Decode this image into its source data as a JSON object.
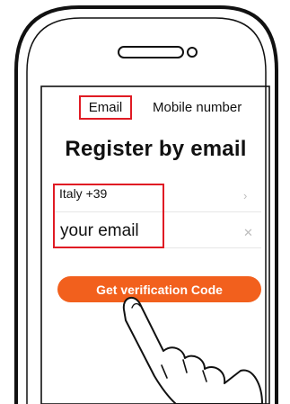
{
  "tabs": {
    "email": "Email",
    "mobile": "Mobile number"
  },
  "page": {
    "title": "Register by email"
  },
  "form": {
    "country": "Italy +39",
    "email_placeholder": "your email",
    "country_chevron_icon": "chevron-right-icon",
    "clear_icon": "close-icon"
  },
  "actions": {
    "get_code": "Get verification Code"
  },
  "colors": {
    "accent": "#f2601d",
    "highlight": "#e01b24"
  }
}
